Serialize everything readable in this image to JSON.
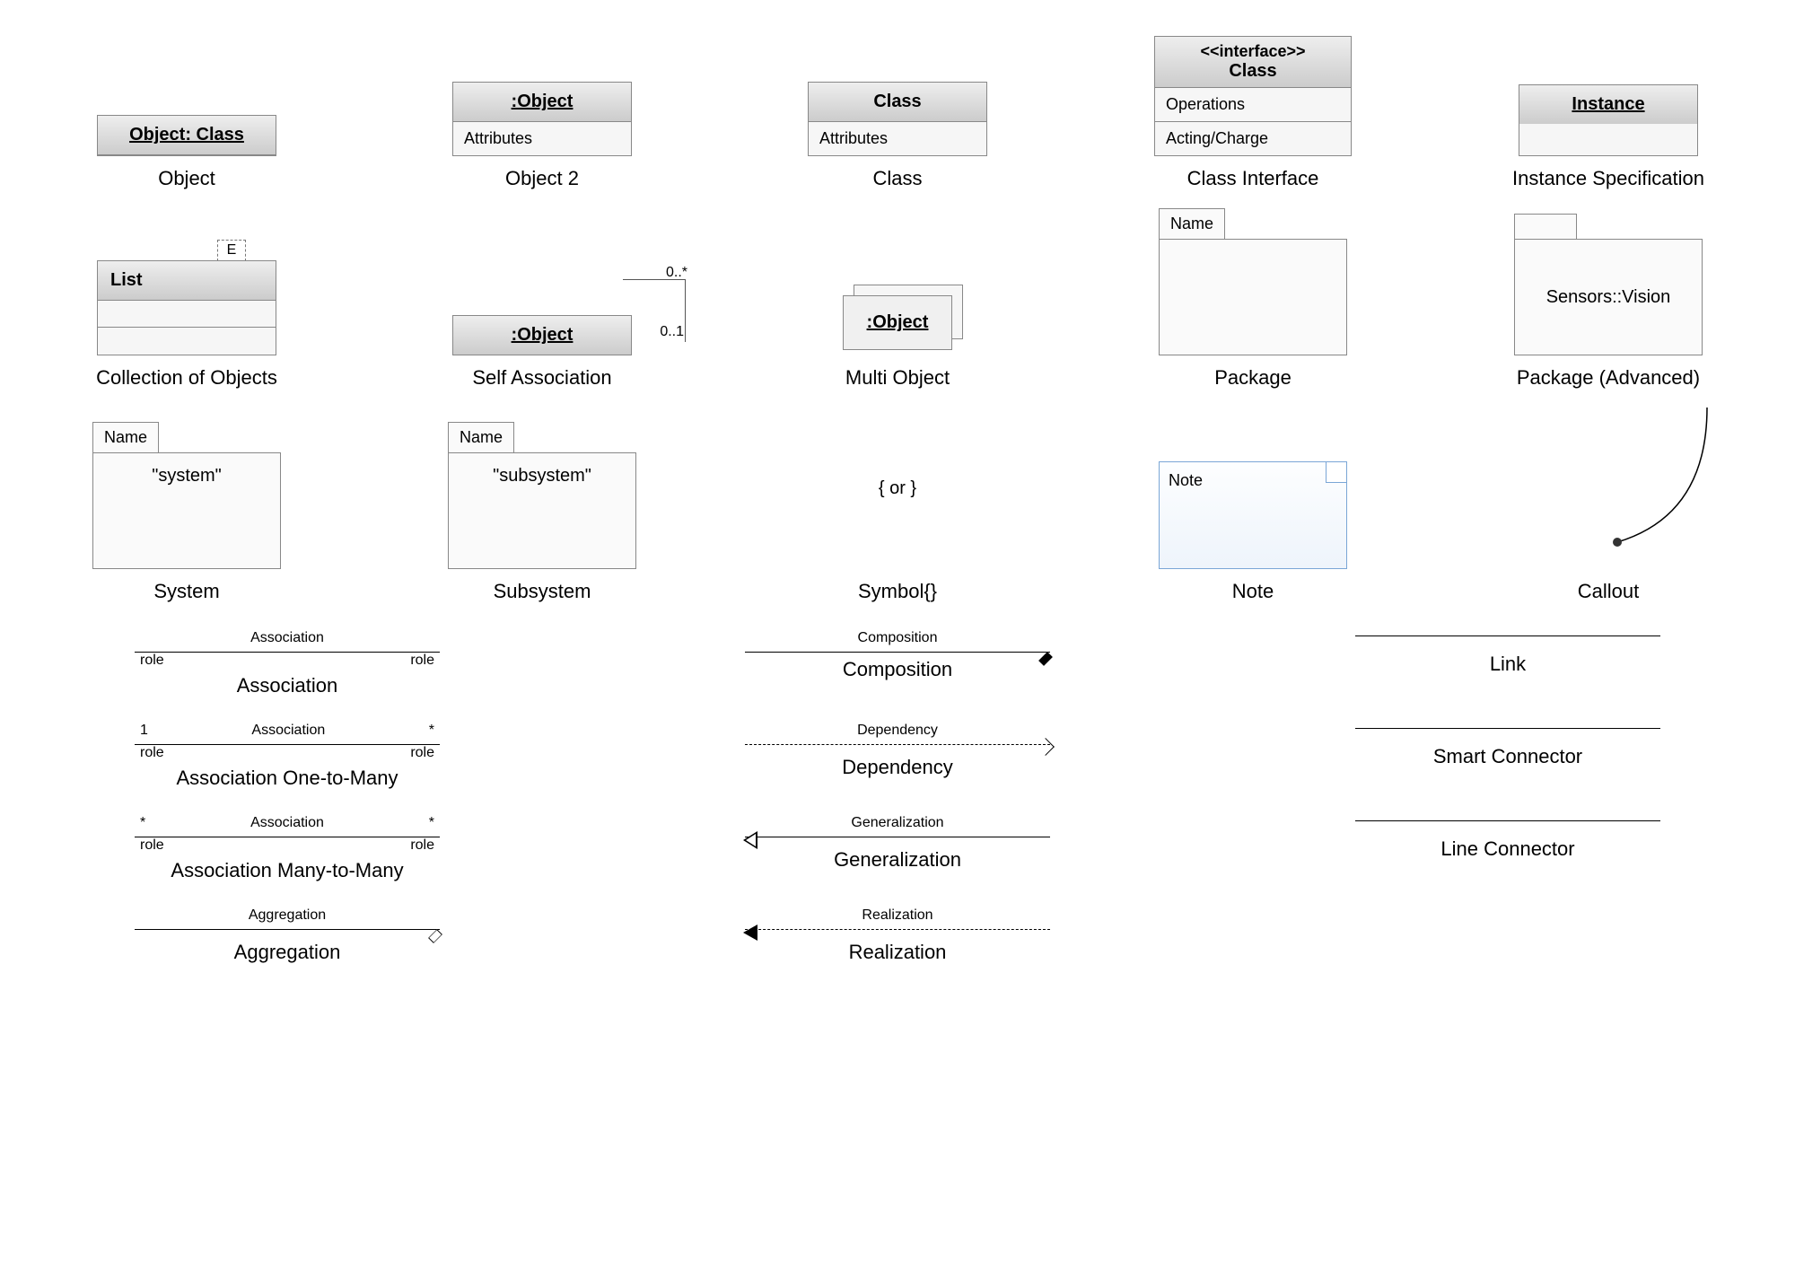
{
  "row1": {
    "object": {
      "header": "Object: Class",
      "caption": "Object"
    },
    "object2": {
      "header": ":Object",
      "attr": "Attributes",
      "caption": "Object 2"
    },
    "class": {
      "header": "Class",
      "attr": "Attributes",
      "caption": "Class"
    },
    "interface": {
      "stereo": "<<interface>>",
      "name": "Class",
      "op": "Operations",
      "charge": "Acting/Charge",
      "caption": "Class Interface"
    },
    "instance": {
      "header": "Instance",
      "caption": "Instance Specification"
    }
  },
  "row2": {
    "collection": {
      "tag": "E",
      "header": "List",
      "caption": "Collection of Objects"
    },
    "selfassoc": {
      "header": ":Object",
      "m1": "0..*",
      "m2": "0..1",
      "caption": "Self Association"
    },
    "multi": {
      "header": ":Object",
      "caption": "Multi Object"
    },
    "package": {
      "tab": "Name",
      "caption": "Package"
    },
    "package2": {
      "body": "Sensors::Vision",
      "caption": "Package (Advanced)"
    }
  },
  "row3": {
    "system": {
      "tab": "Name",
      "body": "\"system\"",
      "caption": "System"
    },
    "subsystem": {
      "tab": "Name",
      "body": "\"subsystem\"",
      "caption": "Subsystem"
    },
    "symbol": {
      "text": "{ or }",
      "caption": "Symbol{}"
    },
    "note": {
      "text": "Note",
      "caption": "Note"
    },
    "callout": {
      "caption": "Callout"
    }
  },
  "conn": {
    "assoc": {
      "top": "Association",
      "l": "role",
      "r": "role",
      "caption": "Association"
    },
    "assoc1m": {
      "l1": "1",
      "mid": "Association",
      "r1": "*",
      "l2": "role",
      "r2": "role",
      "caption": "Association One-to-Many"
    },
    "assocmm": {
      "l1": "*",
      "mid": "Association",
      "r1": "*",
      "l2": "role",
      "r2": "role",
      "caption": "Association Many-to-Many"
    },
    "agg": {
      "top": "Aggregation",
      "caption": "Aggregation"
    },
    "comp": {
      "top": "Composition",
      "caption": "Composition"
    },
    "dep": {
      "top": "Dependency",
      "caption": "Dependency"
    },
    "gen": {
      "top": "Generalization",
      "caption": "Generalization"
    },
    "real": {
      "top": "Realization",
      "caption": "Realization"
    },
    "link": {
      "caption": "Link"
    },
    "smart": {
      "caption": "Smart Connector"
    },
    "line": {
      "caption": "Line Connector"
    }
  }
}
